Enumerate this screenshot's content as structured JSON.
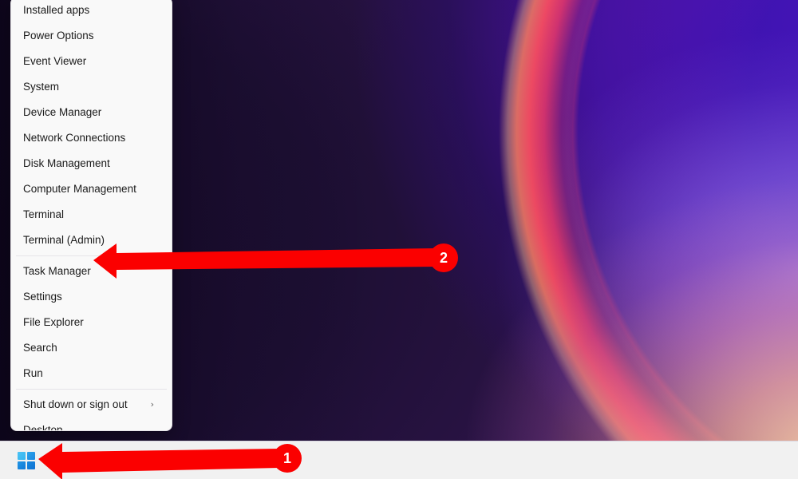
{
  "window": {
    "title": "Windows 11 Desktop with Power User Menu",
    "wallpaper_name": "bloom-wallpaper"
  },
  "colors": {
    "menu_background": "#f9f9f9",
    "menu_text": "#1b1b1b",
    "separator": "#e6e4e8",
    "taskbar_background": "#f1f1f1",
    "annotation_red": "#fb0000",
    "badge_text": "#ffffff",
    "desktop_dark_purple": "#1d0f33",
    "desktop_violet": "#7610c4",
    "desktop_crimson": "#f33a68",
    "desktop_peach": "#ffd6a8",
    "win_logo_blue": "#1b87e0"
  },
  "power_menu": {
    "groups": [
      {
        "items": [
          {
            "label": "Installed apps",
            "has_submenu": false
          },
          {
            "label": "Power Options",
            "has_submenu": false
          },
          {
            "label": "Event Viewer",
            "has_submenu": false
          },
          {
            "label": "System",
            "has_submenu": false
          },
          {
            "label": "Device Manager",
            "has_submenu": false
          },
          {
            "label": "Network Connections",
            "has_submenu": false
          },
          {
            "label": "Disk Management",
            "has_submenu": false
          },
          {
            "label": "Computer Management",
            "has_submenu": false
          },
          {
            "label": "Terminal",
            "has_submenu": false
          },
          {
            "label": "Terminal (Admin)",
            "has_submenu": false
          }
        ]
      },
      {
        "items": [
          {
            "label": "Task Manager",
            "has_submenu": false
          },
          {
            "label": "Settings",
            "has_submenu": false
          },
          {
            "label": "File Explorer",
            "has_submenu": false
          },
          {
            "label": "Search",
            "has_submenu": false
          },
          {
            "label": "Run",
            "has_submenu": false
          }
        ]
      },
      {
        "items": [
          {
            "label": "Shut down or sign out",
            "has_submenu": true,
            "chevron": "›"
          },
          {
            "label": "Desktop",
            "has_submenu": false
          }
        ]
      }
    ]
  },
  "taskbar": {
    "start_button": {
      "name": "Start",
      "icon": "windows-logo-icon"
    }
  },
  "annotations": {
    "badges": [
      {
        "number": "1",
        "target": "start-button"
      },
      {
        "number": "2",
        "target": "task-manager-menu-item"
      }
    ],
    "arrows": [
      {
        "id": "arrow-to-start",
        "points_to": "start-button",
        "direction": "left"
      },
      {
        "id": "arrow-to-task-manager",
        "points_to": "task-manager-menu-item",
        "direction": "left"
      }
    ]
  }
}
